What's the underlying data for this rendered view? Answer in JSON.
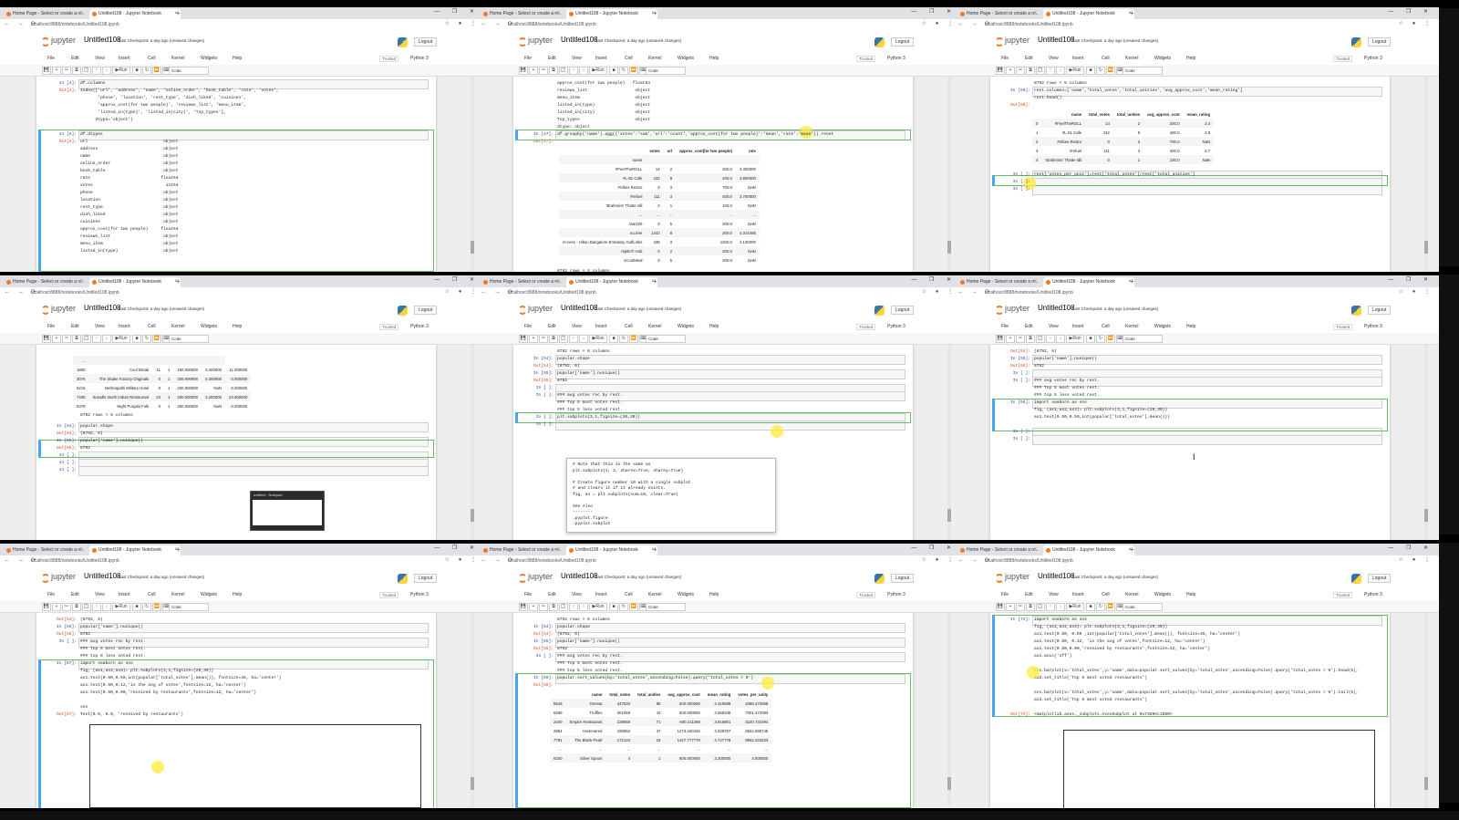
{
  "browser": {
    "tab1_title": "Home Page - Select or create a n...",
    "tab2_title": "Untitled108 - Jupyter Notebook",
    "url": "localhost:8888/notebooks/Untitled108.ipynb"
  },
  "jupyter": {
    "brand": "jupyter",
    "notebook_name": "Untitled108",
    "checkpoint": "Last Checkpoint: a day ago",
    "unsaved": "(unsaved changes)",
    "logout": "Logout",
    "trusted": "Trusted",
    "kernel": "Python 3",
    "menu": [
      "File",
      "Edit",
      "View",
      "Insert",
      "Cell",
      "Kernel",
      "Widgets",
      "Help"
    ],
    "run_label": "Run",
    "celltype": "Code"
  },
  "icons": {
    "new_tab": "+",
    "window_controls": "— ❐ ✕",
    "nav": "← → ⟳",
    "addr_right": "☆ ● ⋮",
    "toolbar": [
      "save",
      "plus",
      "cut",
      "copy",
      "paste",
      "up",
      "down",
      "run",
      "stop",
      "restart",
      "fast-forward",
      "keyboard"
    ],
    "toolbar_glyphs": [
      "💾",
      "+",
      "✂",
      "⧉",
      "📋",
      "↑",
      "↓",
      "▶",
      "■",
      "↻",
      "⏩",
      "⌨"
    ]
  },
  "panels": [
    {
      "lines": [
        {
          "p": "In [4]:",
          "t": "in",
          "c": "df.columns"
        },
        {
          "p": "Out[4]:",
          "t": "out",
          "c": "Index(['url', 'address', 'name', 'online_order', 'book_table', 'rate', 'votes',"
        },
        {
          "p": "",
          "t": "",
          "c": "       'phone', 'location', 'rest_type', 'dish_liked', 'cuisines',"
        },
        {
          "p": "",
          "t": "",
          "c": "       'approx_cost(for two people)', 'reviews_list', 'menu_item',"
        },
        {
          "p": "",
          "t": "",
          "c": "       'listed_in(type)', 'listed_in(city)', 'Top_types'],"
        },
        {
          "p": "",
          "t": "",
          "c": "      dtype='object')"
        },
        {
          "p": "",
          "t": "",
          "c": ""
        },
        {
          "p": "In [6]:",
          "t": "in",
          "c": "df.dtypes"
        },
        {
          "p": "Out[6]:",
          "t": "out",
          "c": "url                              object"
        },
        {
          "p": "",
          "t": "",
          "c": "address                          object"
        },
        {
          "p": "",
          "t": "",
          "c": "name                             object"
        },
        {
          "p": "",
          "t": "",
          "c": "online_order                     object"
        },
        {
          "p": "",
          "t": "",
          "c": "book_table                       object"
        },
        {
          "p": "",
          "t": "",
          "c": "rate                            float64"
        },
        {
          "p": "",
          "t": "",
          "c": "votes                             int64"
        },
        {
          "p": "",
          "t": "",
          "c": "phone                            object"
        },
        {
          "p": "",
          "t": "",
          "c": "location                         object"
        },
        {
          "p": "",
          "t": "",
          "c": "rest_type                        object"
        },
        {
          "p": "",
          "t": "",
          "c": "dish_liked                       object"
        },
        {
          "p": "",
          "t": "",
          "c": "cuisines                         object"
        },
        {
          "p": "",
          "t": "",
          "c": "approx_cost(for two people)     float64"
        },
        {
          "p": "",
          "t": "",
          "c": "reviews_list                     object"
        },
        {
          "p": "",
          "t": "",
          "c": "menu_item                        object"
        },
        {
          "p": "",
          "t": "",
          "c": "listed_in(type)                  object"
        }
      ]
    },
    {
      "lines": [
        {
          "p": "",
          "t": "",
          "c": "approx_cost(for two people)   float64"
        },
        {
          "p": "",
          "t": "",
          "c": "reviews_list                   object"
        },
        {
          "p": "",
          "t": "",
          "c": "menu_item                      object"
        },
        {
          "p": "",
          "t": "",
          "c": "listed_in(type)                object"
        },
        {
          "p": "",
          "t": "",
          "c": "listed_in(city)                object"
        },
        {
          "p": "",
          "t": "",
          "c": "Top_types                      object"
        },
        {
          "p": "",
          "t": "",
          "c": "dtype: object"
        },
        {
          "p": "In [47]:",
          "t": "in",
          "c": "df.groupby('name').agg({'votes':'sum','url':'count','approx_cost(for two people)':'mean','rate':'mean'}).reset"
        },
        {
          "p": "Out[47]:",
          "t": "out",
          "c": ""
        }
      ],
      "table": {
        "headers": [
          "",
          "votes",
          "url",
          "approx_cost(for two people)",
          "rate"
        ],
        "rows": [
          [
            "name",
            "",
            "",
            "",
            ""
          ],
          [
            "#FeelTheROLL",
            "14",
            "2",
            "200.0",
            "3.400000"
          ],
          [
            "#L-81 Cafe",
            "432",
            "9",
            "400.0",
            "3.900000"
          ],
          [
            "#Vibes Restro",
            "0",
            "3",
            "700.0",
            "NaN"
          ],
          [
            "#refuel",
            "111",
            "3",
            "400.0",
            "3.700000"
          ],
          [
            "'Brahmins' Thatte Idli",
            "0",
            "1",
            "100.0",
            "NaN"
          ],
          [
            "...",
            "...",
            "...",
            "...",
            "..."
          ],
          [
            "late100",
            "0",
            "5",
            "200.0",
            "NaN"
          ],
          [
            "nu.tree",
            "1443",
            "8",
            "200.0",
            "4.314286"
          ],
          [
            "re:cess - Hilton Bangalore Embassy GolfLinks",
            "438",
            "3",
            "1200.0",
            "4.100000"
          ],
          [
            "repEAT Hub",
            "0",
            "2",
            "200.0",
            "NaN"
          ],
          [
            "sCoolMeal",
            "0",
            "5",
            "200.0",
            "NaN"
          ]
        ],
        "footer": "8792 rows × 4 columns"
      }
    },
    {
      "lines": [
        {
          "p": "",
          "t": "",
          "c": "8792 rows × 5 columns"
        },
        {
          "p": "In [50]:",
          "t": "in",
          "c": "rest.columns=['name','total_votes','total_unities','avg_approx_cost','mean_rating']"
        },
        {
          "p": "",
          "t": "",
          "c": "rest.head()"
        },
        {
          "p": "Out[50]:",
          "t": "out",
          "c": ""
        }
      ],
      "table": {
        "headers": [
          "",
          "name",
          "total_votes",
          "total_unities",
          "avg_approx_cost",
          "mean_rating"
        ],
        "rows": [
          [
            "0",
            "#FeelTheROLL",
            "14",
            "2",
            "200.0",
            "3.4"
          ],
          [
            "1",
            "#L-81 Cafe",
            "432",
            "9",
            "400.0",
            "3.9"
          ],
          [
            "2",
            "#Vibes Restro",
            "0",
            "3",
            "700.0",
            "NaN"
          ],
          [
            "3",
            "#refuel",
            "111",
            "3",
            "400.0",
            "3.7"
          ],
          [
            "4",
            "'Brahmins' Thatte Idli",
            "0",
            "1",
            "100.0",
            "NaN"
          ]
        ]
      },
      "after": [
        {
          "p": "In [ ]:",
          "t": "in",
          "c": "rest['votes_per_unit']=rest['total_votes']/rest['total_unities']"
        },
        {
          "p": "In [ ]:",
          "t": "in",
          "c": ""
        },
        {
          "p": "In [ ]:",
          "t": "in",
          "c": ""
        }
      ]
    },
    {
      "table": {
        "headers": [
          "",
          "",
          "",
          "",
          "",
          ""
        ],
        "rows": [
          [
            "...",
            "",
            "",
            "",
            "",
            ""
          ],
          [
            "1800",
            "Cool Break",
            "11",
            "1",
            "150.000000",
            "3.400000",
            "11.000000"
          ],
          [
            "3076",
            "The Shake Factory Originals",
            "0",
            "1",
            "200.000000",
            "3.300000",
            "0.000000"
          ],
          [
            "5216",
            "Nethrapathi Military Hotel",
            "0",
            "1",
            "200.000000",
            "NaN",
            "0.000000"
          ],
          [
            "7435",
            "Suradhi North Indian Restaurant",
            "23",
            "1",
            "200.000000",
            "3.200000",
            "23.000000"
          ],
          [
            "5379",
            "Night Punjabi Folk",
            "0",
            "1",
            "250.000000",
            "NaN",
            "0.000000"
          ]
        ],
        "footer": "8792 rows × 6 columns"
      },
      "lines": [
        {
          "p": "In [54]:",
          "t": "in",
          "c": "popular.shape"
        },
        {
          "p": "Out[54]:",
          "t": "out",
          "c": "(8792, 6)"
        },
        {
          "p": "In [55]:",
          "t": "in",
          "c": "popular['name'].nunique()"
        },
        {
          "p": "Out[55]:",
          "t": "out",
          "c": "8792"
        },
        {
          "p": "In [ ]:",
          "t": "in",
          "c": ""
        },
        {
          "p": "In [ ]:",
          "t": "in",
          "c": ""
        },
        {
          "p": "In [ ]:",
          "t": "in",
          "c": ""
        }
      ],
      "notepad_title": "untitled - Notepad"
    },
    {
      "lines": [
        {
          "p": "",
          "t": "",
          "c": "8792 rows × 6 columns"
        },
        {
          "p": "In [54]:",
          "t": "in",
          "c": "popular.shape"
        },
        {
          "p": "Out[54]:",
          "t": "out",
          "c": "(8792, 6)"
        },
        {
          "p": "In [55]:",
          "t": "in",
          "c": "popular['name'].nunique()"
        },
        {
          "p": "Out[55]:",
          "t": "out",
          "c": "8792"
        },
        {
          "p": "In [ ]:",
          "t": "in",
          "c": ""
        },
        {
          "p": "In [ ]:",
          "t": "in",
          "c": "### avg votes rec by rest."
        },
        {
          "p": "",
          "t": "",
          "c": "### Top 5 most votes rest."
        },
        {
          "p": "",
          "t": "",
          "c": "### top 5 less voted rest."
        },
        {
          "p": "In [ ]:",
          "t": "in",
          "c": "plt.subplots(3,1,figsize=(20,30))"
        },
        {
          "p": "In [ ]:",
          "t": "in",
          "c": ""
        }
      ],
      "popup": [
        "# Note that this is the same as",
        "plt.subplots(1, 2, sharex=True, sharey=True)",
        "",
        "# Create figure number 10 with a single subplot",
        "# and clears it if it already exists.",
        "fig, ax = plt.subplots(num=10, clear=True)",
        "",
        "See Also",
        "--------",
        ".pyplot.figure",
        ".pyplot.subplot"
      ]
    },
    {
      "lines": [
        {
          "p": "Out[54]:",
          "t": "out",
          "c": "(8792, 6)"
        },
        {
          "p": "In [55]:",
          "t": "in",
          "c": "popular['name'].nunique()"
        },
        {
          "p": "Out[55]:",
          "t": "out",
          "c": "8792"
        },
        {
          "p": "In [ ]:",
          "t": "in",
          "c": ""
        },
        {
          "p": "In [ ]:",
          "t": "in",
          "c": "### avg votes rec by rest."
        },
        {
          "p": "",
          "t": "",
          "c": "### Top 5 most votes rest."
        },
        {
          "p": "",
          "t": "",
          "c": "### top 5 less voted rest."
        },
        {
          "p": "In [56]:",
          "t": "in",
          "c": "import seaborn as sns"
        },
        {
          "p": "",
          "t": "",
          "c": "fig, (ax1,ax2,ax3)= plt.subplots(3,1,figsize=(20,30))"
        },
        {
          "p": "",
          "t": "",
          "c": "ax1.text(0.50,0.50,int(popular['total_votes'].mean()))"
        },
        {
          "p": "",
          "t": "",
          "c": ""
        },
        {
          "p": "In [ ]:",
          "t": "in",
          "c": ""
        },
        {
          "p": "In [ ]:",
          "t": "in",
          "c": ""
        }
      ]
    },
    {
      "lines": [
        {
          "p": "Out[54]:",
          "t": "out",
          "c": "(8792, 6)"
        },
        {
          "p": "In [55]:",
          "t": "in",
          "c": "popular['name'].nunique()"
        },
        {
          "p": "Out[55]:",
          "t": "out",
          "c": "8792"
        },
        {
          "p": "In [ ]:",
          "t": "in",
          "c": "### avg votes rec by rest."
        },
        {
          "p": "",
          "t": "",
          "c": "### Top 5 most votes rest."
        },
        {
          "p": "",
          "t": "",
          "c": "### top 5 less voted rest."
        },
        {
          "p": "In [67]:",
          "t": "in",
          "c": "import seaborn as sns"
        },
        {
          "p": "",
          "t": "",
          "c": "fig, (ax1,ax2,ax3)= plt.subplots(3,1,figsize=(20,30))"
        },
        {
          "p": "",
          "t": "",
          "c": "ax1.text(0.50,0.50,int(popular['total_votes'].mean()), fontsize=45, ha='center')"
        },
        {
          "p": "",
          "t": "",
          "c": "ax1.text(0.50,0.12,'is the avg of votes',fontsize=12, ha='center')"
        },
        {
          "p": "",
          "t": "",
          "c": "ax1.text(0.50,0.00,'received by restaurants',fontsize=12, ha='center')"
        },
        {
          "p": "",
          "t": "",
          "c": ""
        },
        {
          "p": "",
          "t": "",
          "c": "sns"
        },
        {
          "p": "Out[67]:",
          "t": "out",
          "c": "Text(0.5, 0.0, 'received by restaurants')"
        }
      ]
    },
    {
      "lines": [
        {
          "p": "",
          "t": "",
          "c": "8792 rows × 6 columns"
        },
        {
          "p": "In [54]:",
          "t": "in",
          "c": "popular.shape"
        },
        {
          "p": "Out[54]:",
          "t": "out",
          "c": "(8792, 6)"
        },
        {
          "p": "In [55]:",
          "t": "in",
          "c": "popular['name'].nunique()"
        },
        {
          "p": "Out[55]:",
          "t": "out",
          "c": "8792"
        },
        {
          "p": "In [ ]:",
          "t": "in",
          "c": "### avg votes rec by rest."
        },
        {
          "p": "",
          "t": "",
          "c": "### Top 5 most votes rest."
        },
        {
          "p": "",
          "t": "",
          "c": "### top 5 less voted rest."
        },
        {
          "p": "In [69]:",
          "t": "in",
          "c": "popular.sort_values(by='total_votes',ascending=False).query('total_votes > 0')"
        },
        {
          "p": "Out[69]:",
          "t": "out",
          "c": ""
        }
      ],
      "table": {
        "headers": [
          "",
          "name",
          "total_votes",
          "total_unities",
          "avg_approx_cost",
          "mean_rating",
          "votes_per_unity"
        ],
        "rows": [
          [
            "5549",
            "Onesta",
            "347520",
            "85",
            "600.000000",
            "4.410588",
            "4088.470588"
          ],
          [
            "6269",
            "Truffles",
            "301058",
            "43",
            "600.000000",
            "4.565348",
            "7001.372093"
          ],
          [
            "2440",
            "Empire Restaurant",
            "228658",
            "71",
            "600.211268",
            "3.916901",
            "3220.732394"
          ],
          [
            "2854",
            "Hammered",
            "190652",
            "47",
            "1273.340426",
            "4.329787",
            "3842.595745"
          ],
          [
            "7791",
            "The Black Pearl",
            "172122",
            "18",
            "1427.777778",
            "4.727778",
            "9562.333333"
          ],
          [
            "...",
            "...",
            "...",
            "...",
            "...",
            "...",
            "..."
          ],
          [
            "6340",
            "Silver Spoon",
            "4",
            "1",
            "600.000000",
            "3.300000",
            "4.000000"
          ]
        ]
      }
    },
    {
      "lines": [
        {
          "p": "In [73]:",
          "t": "in",
          "c": "import seaborn as sns"
        },
        {
          "p": "",
          "t": "",
          "c": "fig, (ax1,ax2,ax3)= plt.subplots(3,1,figsize=(20,30))"
        },
        {
          "p": "",
          "t": "",
          "c": "ax1.text(0.50, 0.50 ,int(popular['total_votes'].mean()), fontsize=45, ha='center')"
        },
        {
          "p": "",
          "t": "",
          "c": "ax1.text(0.50, 0.12, 'is the avg of votes',fontsize=12, ha='center')"
        },
        {
          "p": "",
          "t": "",
          "c": "ax1.text(0.50,0.00,'received by restaurants',fontsize=12, ha='center')"
        },
        {
          "p": "",
          "t": "",
          "c": "ax1.axis('off')"
        },
        {
          "p": "",
          "t": "",
          "c": ""
        },
        {
          "p": "",
          "t": "",
          "c": "sns.barplot(x='total_votes',y='name',data=popular.sort_values(by='total_votes',ascending=False).query('total_votes > 0').head(5),"
        },
        {
          "p": "",
          "t": "",
          "c": "ax2.set_title('Top 5 most voted restaurants')"
        },
        {
          "p": "",
          "t": "",
          "c": ""
        },
        {
          "p": "",
          "t": "",
          "c": "sns.barplot(x='total_votes',y='name',data=popular.sort_values(by='total_votes',ascending=False).query('total_votes > 0').tail(5),"
        },
        {
          "p": "",
          "t": "",
          "c": "ax3.set_title('Top 5 most voted restaurants')"
        },
        {
          "p": "",
          "t": "",
          "c": ""
        },
        {
          "p": "Out[73]:",
          "t": "out",
          "c": "<matplotlib.axes._subplots.AxesSubplot at 0x7360ec1880>"
        }
      ]
    }
  ]
}
